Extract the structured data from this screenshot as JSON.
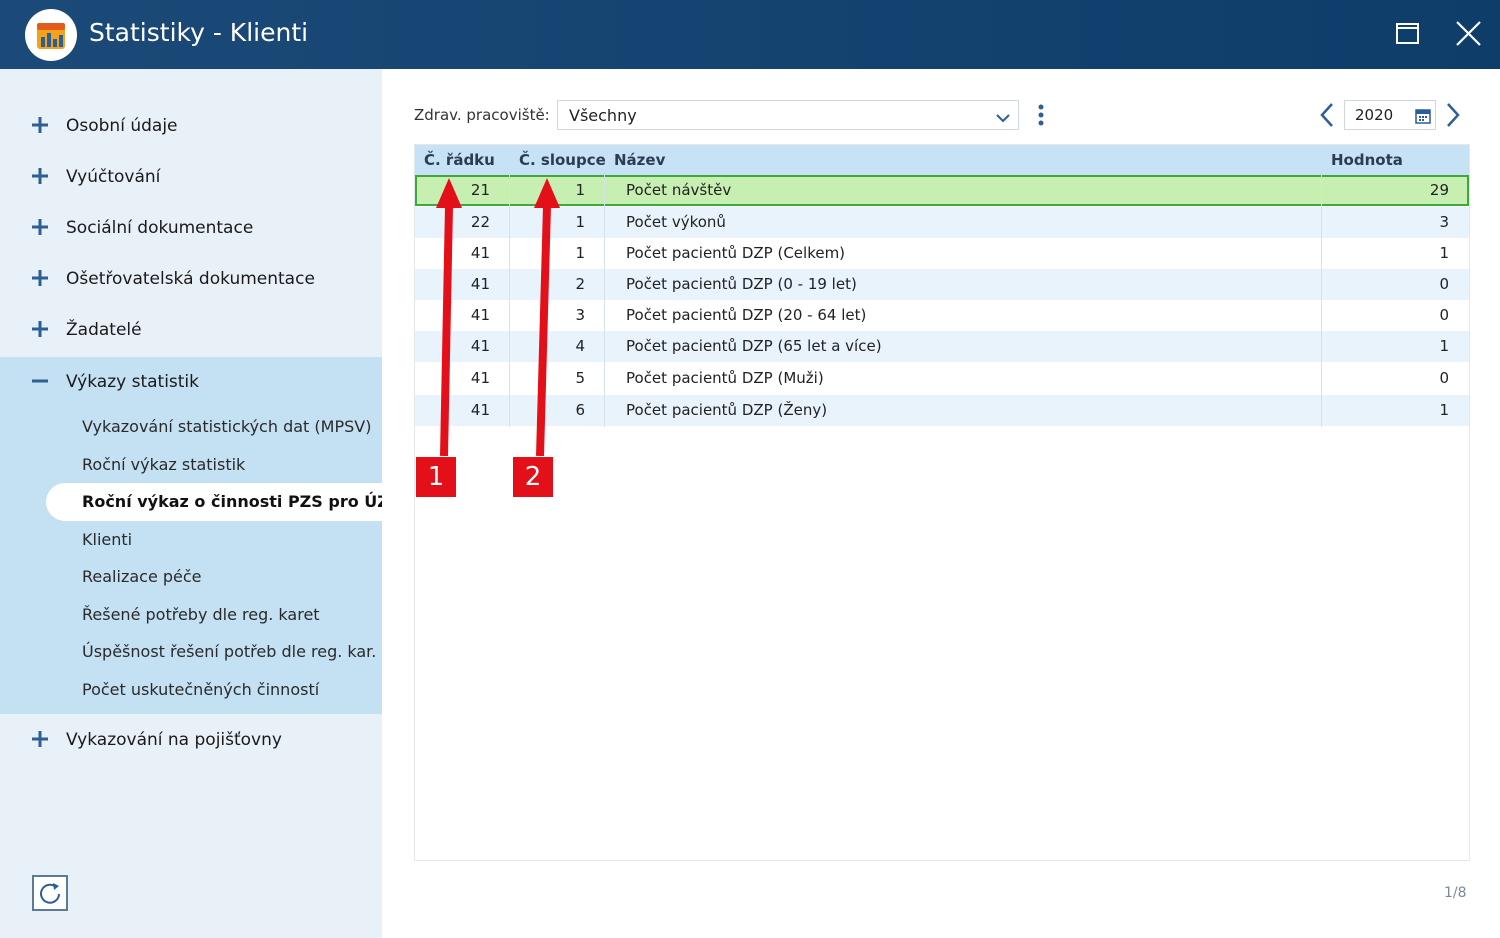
{
  "window": {
    "title": "Statistiky - Klienti",
    "icons": [
      "app-logo-icon",
      "maximize-icon",
      "close-icon"
    ]
  },
  "sidebar": {
    "items": [
      {
        "label": "Osobní údaje",
        "icon": "plus-icon"
      },
      {
        "label": "Vyúčtování",
        "icon": "plus-icon"
      },
      {
        "label": "Sociální dokumentace",
        "icon": "plus-icon"
      },
      {
        "label": "Ošetřovatelská dokumentace",
        "icon": "plus-icon"
      },
      {
        "label": "Žadatelé",
        "icon": "plus-icon"
      },
      {
        "label": "Výkazy statistik",
        "icon": "minus-icon"
      },
      {
        "label": "Vykazování na pojišťovny",
        "icon": "plus-icon"
      }
    ],
    "sub_items": [
      "Vykazování statistických dat (MPSV)",
      "Roční výkaz statistik",
      "Roční výkaz o činnosti PZS pro ÚZIS",
      "Klienti",
      "Realizace péče",
      "Řešené potřeby dle reg. karet",
      "Úspěšnost řešení potřeb dle reg. kar.",
      "Počet uskutečněných činností"
    ],
    "active_sub_index": 2,
    "refresh_icon": "refresh-icon"
  },
  "toolbar": {
    "filter_label": "Zdrav. pracoviště:",
    "filter_value": "Všechny",
    "year": "2020"
  },
  "table": {
    "headers": [
      "Č. řádku",
      "Č. sloupce",
      "Název",
      "Hodnota"
    ],
    "rows": [
      {
        "radek": "21",
        "sloupec": "1",
        "nazev": "Počet návštěv",
        "hodnota": "29"
      },
      {
        "radek": "22",
        "sloupec": "1",
        "nazev": "Počet výkonů",
        "hodnota": "3"
      },
      {
        "radek": "41",
        "sloupec": "1",
        "nazev": "Počet pacientů DZP (Celkem)",
        "hodnota": "1"
      },
      {
        "radek": "41",
        "sloupec": "2",
        "nazev": "Počet pacientů DZP (0 - 19 let)",
        "hodnota": "0"
      },
      {
        "radek": "41",
        "sloupec": "3",
        "nazev": "Počet pacientů DZP (20 - 64 let)",
        "hodnota": "0"
      },
      {
        "radek": "41",
        "sloupec": "4",
        "nazev": "Počet pacientů DZP (65 let a více)",
        "hodnota": "1"
      },
      {
        "radek": "41",
        "sloupec": "5",
        "nazev": "Počet pacientů DZP (Muži)",
        "hodnota": "0"
      },
      {
        "radek": "41",
        "sloupec": "6",
        "nazev": "Počet pacientů DZP (Ženy)",
        "hodnota": "1"
      }
    ],
    "selected_index": 0
  },
  "pager": "1/8",
  "annotations": [
    {
      "label": "1",
      "color": "#e3101a"
    },
    {
      "label": "2",
      "color": "#e3101a"
    }
  ]
}
